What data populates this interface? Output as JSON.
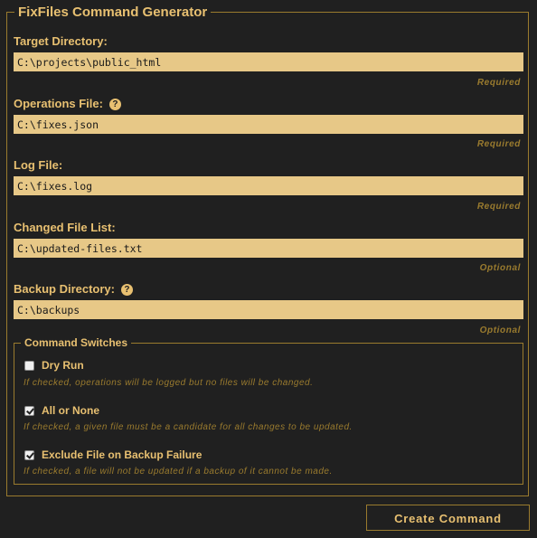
{
  "app": {
    "title": "FixFiles Command Generator"
  },
  "fields": [
    {
      "label": "Target Directory:",
      "value": "C:\\projects\\public_html",
      "note": "Required",
      "has_help": false
    },
    {
      "label": "Operations File:",
      "value": "C:\\fixes.json",
      "note": "Required",
      "has_help": true
    },
    {
      "label": "Log File:",
      "value": "C:\\fixes.log",
      "note": "Required",
      "has_help": false
    },
    {
      "label": "Changed File List:",
      "value": "C:\\updated-files.txt",
      "note": "Optional",
      "has_help": false
    },
    {
      "label": "Backup Directory:",
      "value": "C:\\backups",
      "note": "Optional",
      "has_help": true
    }
  ],
  "help_glyph": "?",
  "switches": {
    "legend": "Command Switches",
    "items": [
      {
        "label": "Dry Run",
        "checked": false,
        "description": "If checked, operations will be logged but no files will be changed."
      },
      {
        "label": "All or None",
        "checked": true,
        "description": "If checked, a given file must be a candidate for all changes to be updated."
      },
      {
        "label": "Exclude File on Backup Failure",
        "checked": true,
        "description": "If checked, a file will not be updated if a backup of it cannot be made."
      }
    ]
  },
  "actions": {
    "create_label": "Create Command"
  },
  "colors": {
    "background": "#202020",
    "accent": "#e8c071",
    "border": "#9a7b2e",
    "input_bg": "#e7c887"
  }
}
